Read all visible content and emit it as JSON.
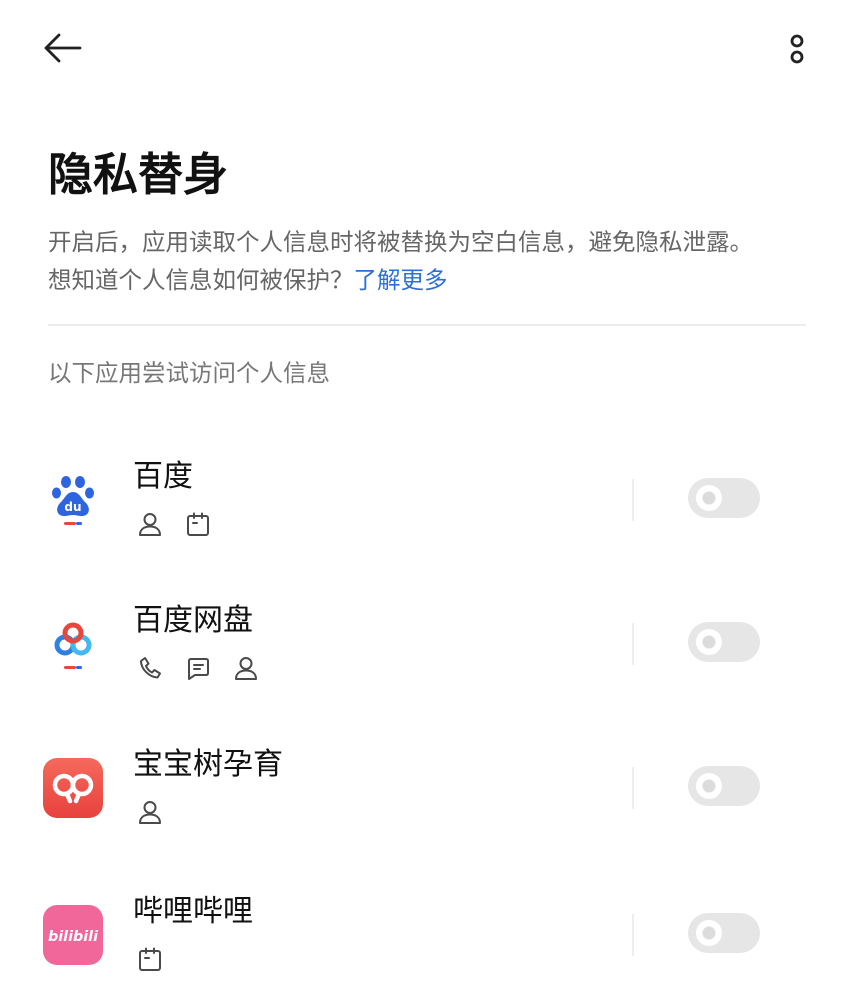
{
  "header": {
    "back_icon": "back-arrow-icon",
    "more_icon": "more-options-icon"
  },
  "page": {
    "title": "隐私替身",
    "description_line1": "开启后，应用读取个人信息时将被替换为空白信息，避免隐私泄露。",
    "description_line2": "想知道个人信息如何被保护？",
    "learn_more_link": "了解更多",
    "section_label": "以下应用尝试访问个人信息"
  },
  "colors": {
    "link": "#2d6fd9",
    "text_primary": "#111111",
    "text_secondary": "#666666",
    "toggle_off": "#e6e6e6"
  },
  "apps": [
    {
      "name": "百度",
      "app_icon": "baidu-app-icon",
      "logo_text": "du",
      "permissions": [
        "person-icon",
        "calendar-icon"
      ],
      "privacy_mask_enabled": false
    },
    {
      "name": "百度网盘",
      "app_icon": "baidu-netdisk-app-icon",
      "permissions": [
        "phone-icon",
        "message-icon",
        "person-icon"
      ],
      "privacy_mask_enabled": false
    },
    {
      "name": "宝宝树孕育",
      "app_icon": "babytree-app-icon",
      "permissions": [
        "person-icon"
      ],
      "privacy_mask_enabled": false
    },
    {
      "name": "哔哩哔哩",
      "app_icon": "bilibili-app-icon",
      "logo_text": "bilibili",
      "permissions": [
        "calendar-icon"
      ],
      "privacy_mask_enabled": false
    }
  ]
}
